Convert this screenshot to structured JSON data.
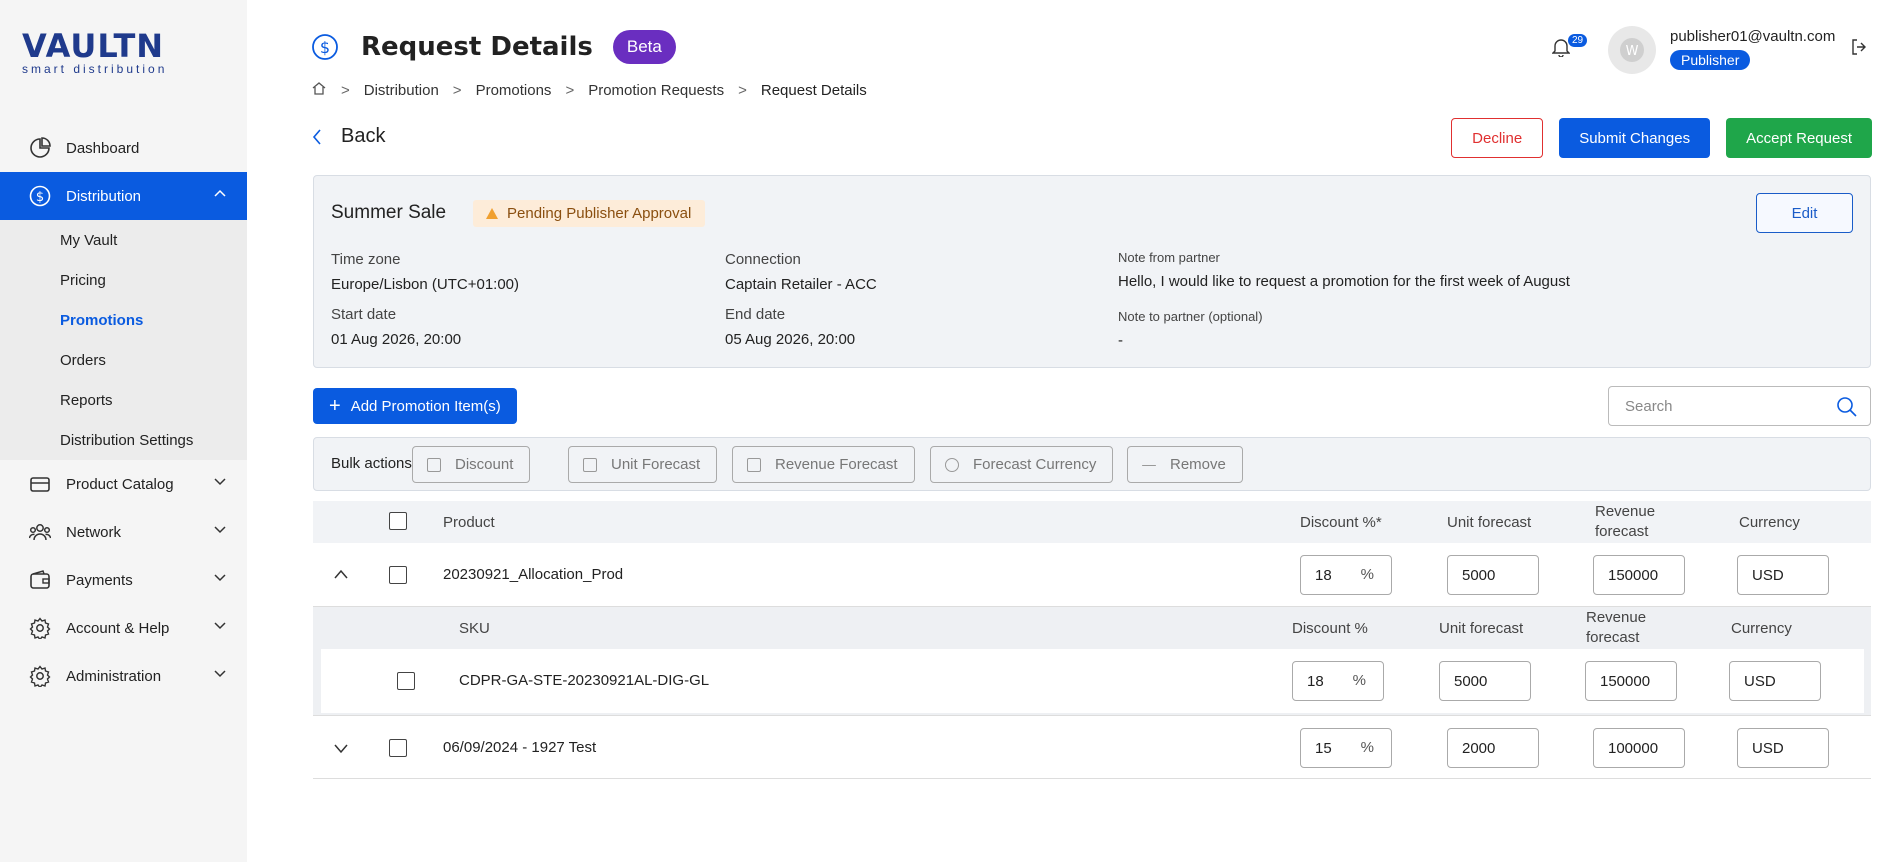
{
  "logo": {
    "brand": "VAULTN",
    "tagline": "smart distribution"
  },
  "sidebar": {
    "items": [
      {
        "label": "Dashboard"
      },
      {
        "label": "Distribution"
      },
      {
        "label": "Product Catalog"
      },
      {
        "label": "Network"
      },
      {
        "label": "Payments"
      },
      {
        "label": "Account & Help"
      },
      {
        "label": "Administration"
      }
    ],
    "distribution_sub": [
      {
        "label": "My Vault"
      },
      {
        "label": "Pricing"
      },
      {
        "label": "Promotions"
      },
      {
        "label": "Orders"
      },
      {
        "label": "Reports"
      },
      {
        "label": "Distribution Settings"
      }
    ]
  },
  "header": {
    "title": "Request Details",
    "beta": "Beta",
    "breadcrumbs": [
      "Distribution",
      "Promotions",
      "Promotion Requests",
      "Request Details"
    ],
    "notifications_count": "29",
    "user_email": "publisher01@vaultn.com",
    "user_role": "Publisher"
  },
  "actions": {
    "back": "Back",
    "decline": "Decline",
    "submit": "Submit Changes",
    "accept": "Accept Request"
  },
  "promo": {
    "name": "Summer Sale",
    "status": "Pending Publisher Approval",
    "edit": "Edit",
    "timezone_label": "Time zone",
    "timezone": "Europe/Lisbon (UTC+01:00)",
    "connection_label": "Connection",
    "connection": "Captain Retailer - ACC",
    "start_label": "Start date",
    "start": "01 Aug 2026, 20:00",
    "end_label": "End date",
    "end": "05 Aug 2026, 20:00",
    "note_from_label": "Note from partner",
    "note_from": "Hello, I would like to request a promotion for the first week of August",
    "note_to_label": "Note to partner (optional)",
    "note_to": "-"
  },
  "toolbar": {
    "add_items": "Add Promotion Item(s)",
    "search_placeholder": "Search"
  },
  "bulk": {
    "label": "Bulk actions:",
    "buttons": [
      "Discount",
      "Unit Forecast",
      "Revenue Forecast",
      "Forecast Currency",
      "Remove"
    ]
  },
  "table": {
    "headers": {
      "product": "Product",
      "discount": "Discount %*",
      "unit": "Unit forecast",
      "revenue1": "Revenue",
      "revenue2": "forecast",
      "currency": "Currency"
    },
    "rows": [
      {
        "product": "20230921_Allocation_Prod",
        "discount": "18",
        "unit": "5000",
        "revenue": "150000",
        "currency": "USD"
      },
      {
        "product": "06/09/2024 - 1927 Test",
        "discount": "15",
        "unit": "2000",
        "revenue": "100000",
        "currency": "USD"
      }
    ],
    "pct": "%",
    "sku_headers": {
      "sku": "SKU",
      "discount": "Discount %",
      "unit": "Unit forecast",
      "revenue1": "Revenue",
      "revenue2": "forecast",
      "currency": "Currency"
    },
    "sku_row": {
      "sku": "CDPR-GA-STE-20230921AL-DIG-GL",
      "discount": "18",
      "unit": "5000",
      "revenue": "150000",
      "currency": "USD"
    }
  }
}
